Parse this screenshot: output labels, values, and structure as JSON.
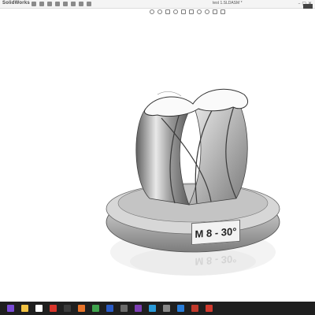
{
  "app": {
    "logo_text": "SolidWorks",
    "document_title": "test 1.SLDASM *",
    "window_controls": "–  ▢  ✕"
  },
  "model": {
    "label_text": "M 8 - 30°",
    "reflection_text": "M 8 - 30°"
  },
  "taskbar": {
    "icons": [
      {
        "name": "start-icon",
        "color": "#7a4bd6"
      },
      {
        "name": "file-explorer-icon",
        "color": "#f3c343"
      },
      {
        "name": "calendar-icon",
        "color": "#ffffff"
      },
      {
        "name": "pdf-icon",
        "color": "#d9352b"
      },
      {
        "name": "app-icon",
        "color": "#3b3b3b"
      },
      {
        "name": "firefox-icon",
        "color": "#e8742a"
      },
      {
        "name": "chrome-icon",
        "color": "#3fa34d"
      },
      {
        "name": "photos-icon",
        "color": "#2b5cc6"
      },
      {
        "name": "calculator-icon",
        "color": "#6b6b6b"
      },
      {
        "name": "onenote-icon",
        "color": "#7d3fb5"
      },
      {
        "name": "edge-icon",
        "color": "#2a9ad8"
      },
      {
        "name": "app2-icon",
        "color": "#888888"
      },
      {
        "name": "mail-icon",
        "color": "#2a7dd8"
      },
      {
        "name": "app3-icon",
        "color": "#c0392b"
      },
      {
        "name": "solidworks-icon",
        "color": "#d23a2e"
      }
    ]
  },
  "colors": {
    "part_light": "#e6e6e6",
    "part_dark": "#6f6f6f",
    "background": "#ffffff"
  }
}
